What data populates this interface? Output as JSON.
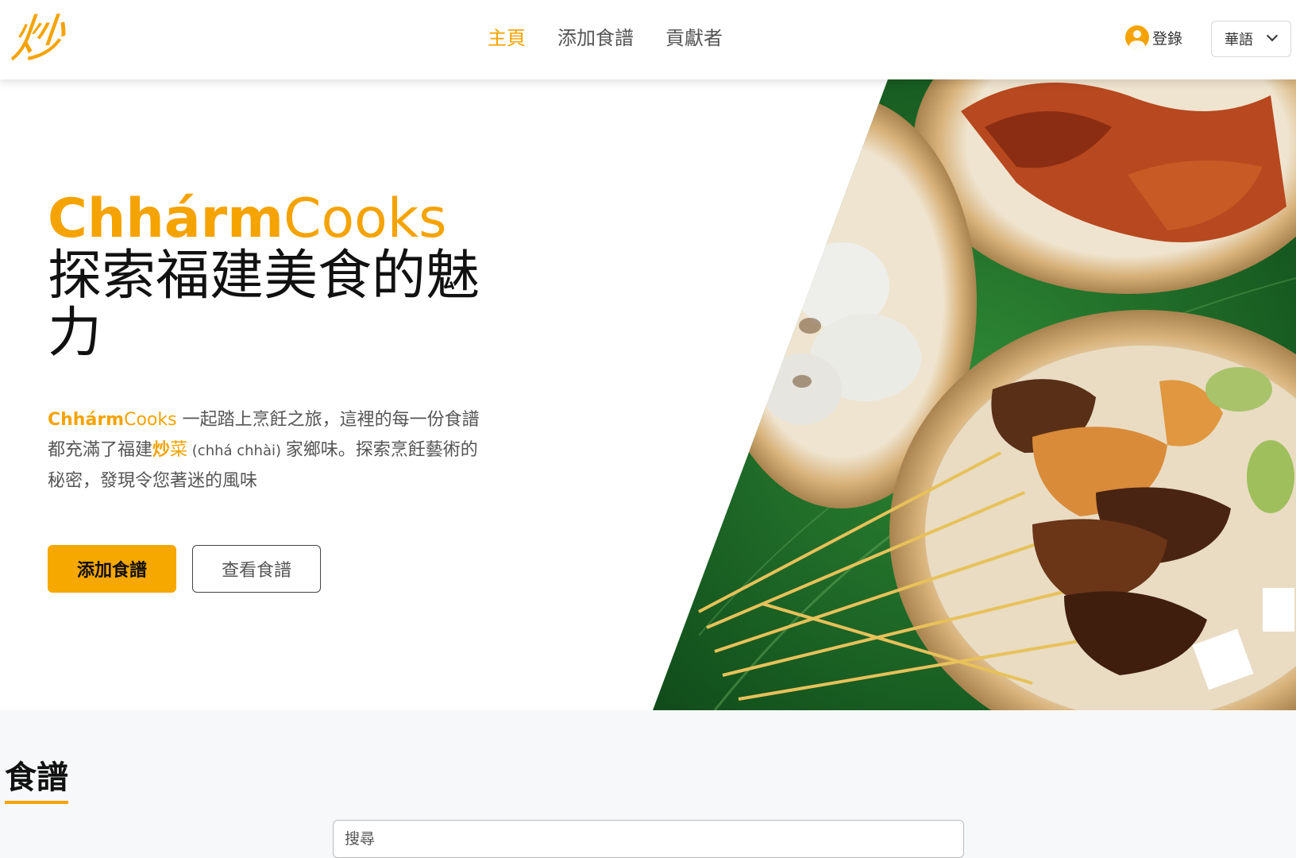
{
  "header": {
    "logo_text": "炒",
    "nav": [
      {
        "label": "主頁",
        "active": true
      },
      {
        "label": "添加食譜",
        "active": false
      },
      {
        "label": "貢獻者",
        "active": false
      }
    ],
    "login_label": "登錄",
    "language": "華語"
  },
  "hero": {
    "brand_bold": "Chhárm",
    "brand_light": "Cooks",
    "title_rest": " 探索福建美食的魅力",
    "desc": {
      "brand_bold": "Chhárm",
      "brand_light": "Cooks",
      "text1": " 一起踏上烹飪之旅，這裡的每一份食譜都充滿了福建",
      "chao": "炒",
      "cai": "菜",
      "pronunciation": " (chhá chhài) ",
      "text2": "家鄉味。探索烹飪藝術的秘密，發現令您著迷的風味"
    },
    "primary_button": "添加食譜",
    "secondary_button": "查看食譜"
  },
  "recipes": {
    "title": "食譜",
    "search_placeholder": "搜尋"
  },
  "colors": {
    "accent": "#f5a300",
    "banana_leaf": "#1f6b2a",
    "basket": "#d9b27a"
  },
  "icons": [
    "user-icon",
    "chevron-down-icon"
  ]
}
